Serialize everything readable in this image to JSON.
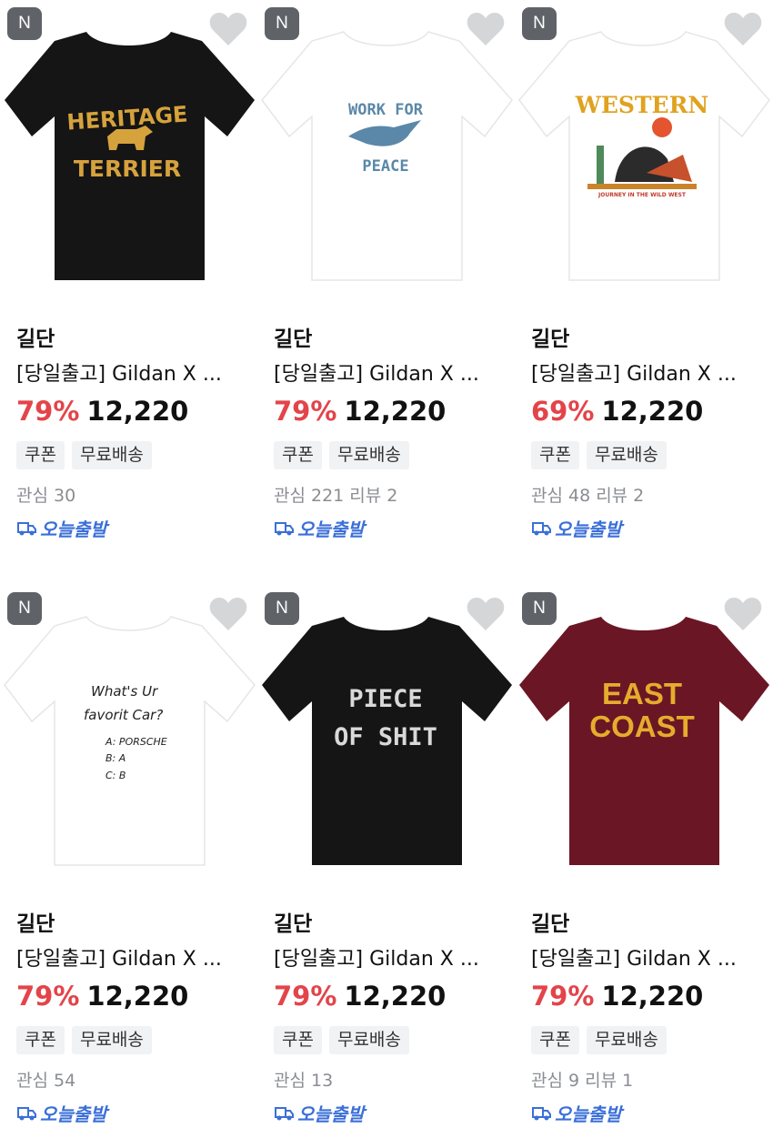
{
  "colors": {
    "discount": "#e3444a",
    "shipping": "#3b6fd8",
    "badge": "#5f6267"
  },
  "products": [
    {
      "badge": "N",
      "brand": "길단",
      "title": "[당일출고] Gildan X ...",
      "discount": "79%",
      "price": "12,220",
      "tags": [
        "쿠폰",
        "무료배송"
      ],
      "interest": "관심 30",
      "reviews": "",
      "shipping": "오늘출발",
      "shirt_color": "#151515",
      "print_lines": [
        "HERITAGE",
        "TERRIER"
      ],
      "print_color": "#d6a23c",
      "icons": [
        "heart-icon",
        "truck-icon",
        "dog-icon"
      ]
    },
    {
      "badge": "N",
      "brand": "길단",
      "title": "[당일출고] Gildan X ...",
      "discount": "79%",
      "price": "12,220",
      "tags": [
        "쿠폰",
        "무료배송"
      ],
      "interest": "관심 221",
      "reviews": "리뷰 2",
      "shipping": "오늘출발",
      "shirt_color": "#ffffff",
      "print_lines": [
        "WORK FOR",
        "PEACE"
      ],
      "print_color": "#5b88a8",
      "icons": [
        "heart-icon",
        "truck-icon",
        "dove-icon"
      ]
    },
    {
      "badge": "N",
      "brand": "길단",
      "title": "[당일출고] Gildan X ...",
      "discount": "69%",
      "price": "12,220",
      "tags": [
        "쿠폰",
        "무료배송"
      ],
      "interest": "관심 48",
      "reviews": "리뷰 2",
      "shipping": "오늘출발",
      "shirt_color": "#ffffff",
      "print_lines": [
        "WESTERN",
        "JOURNEY IN THE WILD WEST"
      ],
      "print_color": "#e0a21f",
      "icons": [
        "heart-icon",
        "truck-icon",
        "western-graphic"
      ]
    },
    {
      "badge": "N",
      "brand": "길단",
      "title": "[당일출고] Gildan X ...",
      "discount": "79%",
      "price": "12,220",
      "tags": [
        "쿠폰",
        "무료배송"
      ],
      "interest": "관심 54",
      "reviews": "",
      "shipping": "오늘출발",
      "shirt_color": "#ffffff",
      "print_lines": [
        "What's Ur",
        "favorit Car?",
        "A: PORSCHE",
        "B: A",
        "C: B"
      ],
      "print_color": "#222222",
      "icons": [
        "heart-icon",
        "truck-icon"
      ]
    },
    {
      "badge": "N",
      "brand": "길단",
      "title": "[당일출고] Gildan X ...",
      "discount": "79%",
      "price": "12,220",
      "tags": [
        "쿠폰",
        "무료배송"
      ],
      "interest": "관심 13",
      "reviews": "",
      "shipping": "오늘출발",
      "shirt_color": "#151515",
      "print_lines": [
        "PIECE",
        "OF SHIT"
      ],
      "print_color": "#d9d9d9",
      "icons": [
        "heart-icon",
        "truck-icon"
      ]
    },
    {
      "badge": "N",
      "brand": "길단",
      "title": "[당일출고] Gildan X ...",
      "discount": "79%",
      "price": "12,220",
      "tags": [
        "쿠폰",
        "무료배송"
      ],
      "interest": "관심 9",
      "reviews": "리뷰 1",
      "shipping": "오늘출발",
      "shirt_color": "#6b1624",
      "print_lines": [
        "EAST",
        "COAST"
      ],
      "print_color": "#e5ac2e",
      "icons": [
        "heart-icon",
        "truck-icon"
      ]
    }
  ]
}
